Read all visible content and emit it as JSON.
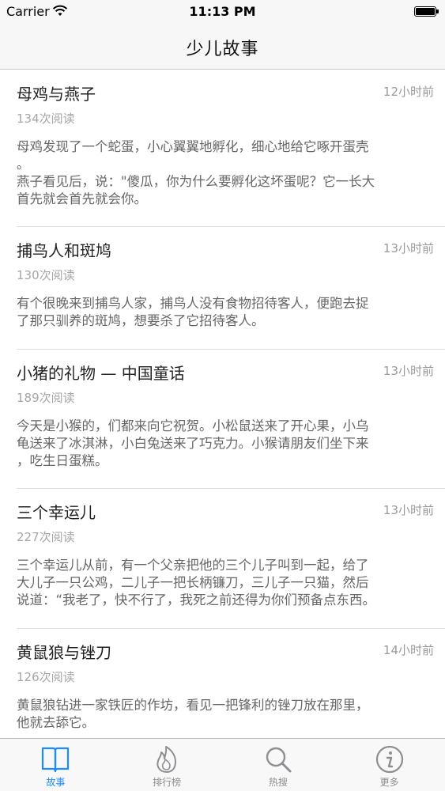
{
  "status_bar": {
    "carrier": "Carrier",
    "time": "11:13 PM",
    "wifi_icon": "wifi-icon",
    "battery_icon": "battery-icon",
    "battery_level": 1.0
  },
  "nav": {
    "title": "少儿故事"
  },
  "stories": [
    {
      "title": "母鸡与燕子",
      "time": "12小时前",
      "reads": "134次阅读",
      "excerpt": "母鸡发现了一个蛇蛋，小心翼翼地孵化，细心地给它啄开蛋壳\n。\n燕子看见后，说：\"傻瓜，你为什么要孵化这坏蛋呢？它一长大\n首先就会首先就会你。"
    },
    {
      "title": "捕鸟人和斑鸠",
      "time": "13小时前",
      "reads": "130次阅读",
      "excerpt": "有个很晚来到捕鸟人家，捕鸟人没有食物招待客人，便跑去捉\n了那只驯养的斑鸠，想要杀了它招待客人。"
    },
    {
      "title": "小猪的礼物 — 中国童话",
      "time": "13小时前",
      "reads": "189次阅读",
      "excerpt": "今天是小猴的，们都来向它祝贺。小松鼠送来了开心果，小乌\n龟送来了冰淇淋，小白兔送来了巧克力。小猴请朋友们坐下来\n，吃生日蛋糕。"
    },
    {
      "title": "三个幸运儿",
      "time": "13小时前",
      "reads": "227次阅读",
      "excerpt": "三个幸运儿从前，有一个父亲把他的三个儿子叫到一起，给了\n大儿子一只公鸡，二儿子一把长柄镰刀，三儿子一只猫，然后\n说道：“我老了，快不行了，我死之前还得为你们预备点东西。"
    },
    {
      "title": "黄鼠狼与锉刀",
      "time": "14小时前",
      "reads": "126次阅读",
      "excerpt": "黄鼠狼钻进一家铁匠的作坊，看见一把锋利的锉刀放在那里，\n他就去舔它。"
    }
  ],
  "tabs": [
    {
      "label": "故事",
      "icon": "book-icon",
      "active": true
    },
    {
      "label": "排行榜",
      "icon": "flame-icon",
      "active": false
    },
    {
      "label": "热搜",
      "icon": "search-icon",
      "active": false
    },
    {
      "label": "更多",
      "icon": "info-icon",
      "active": false
    }
  ],
  "colors": {
    "accent": "#1a8cff",
    "tab_inactive": "#8e8e93",
    "meta_text": "#9a9a9a",
    "excerpt_text": "#666666"
  }
}
